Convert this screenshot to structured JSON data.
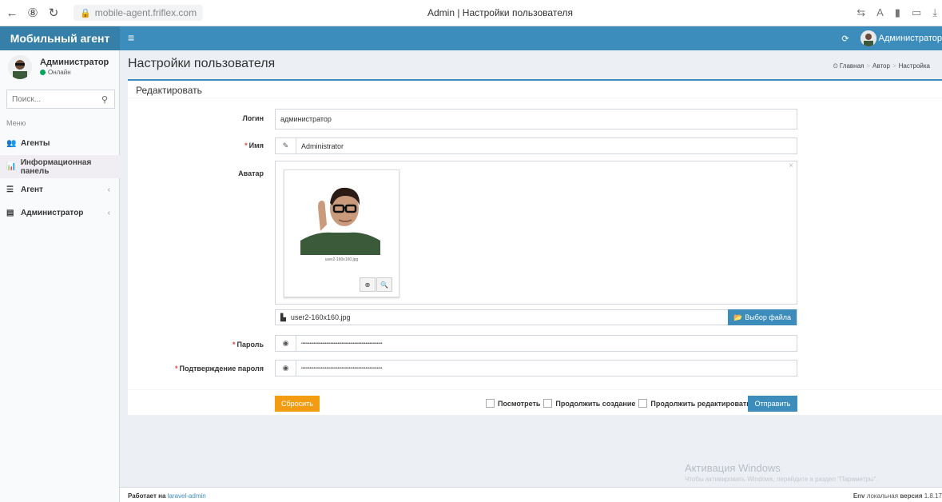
{
  "browser": {
    "url": "mobile-agent.friflex.com",
    "tab_title": "Admin | Настройки пользователя"
  },
  "header": {
    "logo": "Мобильный агент",
    "user": "Администратор"
  },
  "sidebar": {
    "user_name": "Администратор",
    "user_status": "Онлайн",
    "search_placeholder": "Поиск...",
    "menu_head": "Меню",
    "items": [
      {
        "label": "Агенты"
      },
      {
        "label": "Информационная панель"
      },
      {
        "label": "Агент"
      },
      {
        "label": "Администратор"
      }
    ]
  },
  "content": {
    "page_title": "Настройки пользователя",
    "breadcrumb": [
      "Главная",
      "Автор",
      "Настройка"
    ],
    "box_title": "Редактировать"
  },
  "form": {
    "login_label": "Логин",
    "login_value": "администратор",
    "name_label": "Имя",
    "name_value": "Administrator",
    "avatar_label": "Аватар",
    "avatar_caption": "user2-160x160.jpg",
    "file_name": "user2-160x160.jpg",
    "file_button": "Выбор файла",
    "password_label": "Пароль",
    "password_value": "••••••••••••••••••••••••••••••••••••••••••••••••••••••••••",
    "confirm_label": "Подтверждение пароля",
    "confirm_value": "••••••••••••••••••••••••••••••••••••••••••••••••••••••••••",
    "reset_button": "Сбросить",
    "check_view": "Посмотреть",
    "check_continue_create": "Продолжить создание",
    "check_continue_edit": "Продолжить редактировать",
    "submit_button": "Отправить"
  },
  "watermark": {
    "line1": "Активация Windows",
    "line2": "Чтобы активировать Windows, перейдите в раздел \"Параметры\"."
  },
  "footer": {
    "powered_prefix": "Работает на",
    "powered_link": "laravel-admin",
    "env_label": "Env",
    "env_value": "локальная",
    "version_label": "версия",
    "version_value": "1.8.17"
  }
}
